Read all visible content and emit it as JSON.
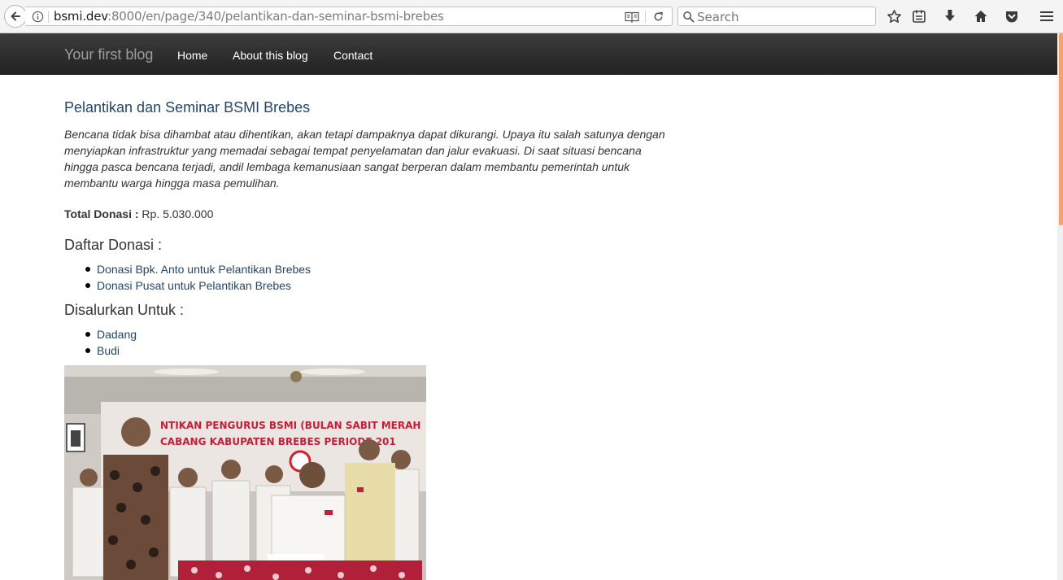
{
  "browser": {
    "url_host": "bsmi.dev",
    "url_rest": ":8000/en/page/340/pelantikan-dan-seminar-bsmi-brebes",
    "search_placeholder": "Search",
    "icons": [
      "back-arrow-icon",
      "info-icon",
      "reader-view-icon",
      "reload-icon",
      "search-icon",
      "bookmark-star-icon",
      "reading-list-icon",
      "download-icon",
      "home-icon",
      "pocket-icon",
      "menu-icon"
    ]
  },
  "site": {
    "brand": "Your first blog",
    "nav": [
      {
        "label": "Home"
      },
      {
        "label": "About this blog"
      },
      {
        "label": "Contact"
      }
    ]
  },
  "post": {
    "title": "Pelantikan dan Seminar BSMI Brebes",
    "excerpt": "Bencana tidak bisa dihambat atau dihentikan, akan tetapi dampaknya dapat dikurangi. Upaya itu salah satunya dengan menyiapkan infrastruktur yang memadai sebagai tempat penyelamatan dan jalur evakuasi. Di saat situasi bencana hingga pasca bencana terjadi, andil lembaga kemanusiaan sangat berperan dalam membantu pemerintah untuk membantu warga hingga masa pemulihan.",
    "total_label": "Total Donasi :",
    "total_value": "Rp. 5.030.000",
    "donations_heading": "Daftar Donasi :",
    "donations": [
      "Donasi Bpk. Anto untuk Pelantikan Brebes",
      "Donasi Pusat untuk Pelantikan Brebes"
    ],
    "recipients_heading": "Disalurkan Untuk :",
    "recipients": [
      "Dadang",
      "Budi"
    ],
    "photo_banner_line1": "NTIKAN PENGURUS BSMI (BULAN SABIT MERAH",
    "photo_banner_line2": "CABANG KABUPATEN BREBES PERIODE 201"
  },
  "colors": {
    "navbar": "#222222",
    "link": "#23476b",
    "brand_text": "#9d9d9d",
    "scroll_thumb": "#f3a36b"
  }
}
